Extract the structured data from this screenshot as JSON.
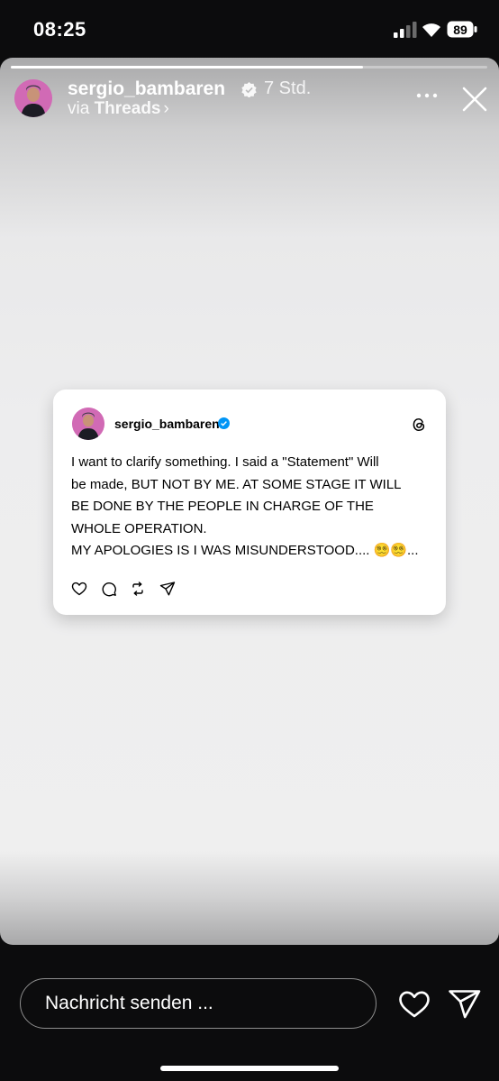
{
  "status_bar": {
    "time": "08:25",
    "battery_level": "89"
  },
  "story": {
    "progress": 0.74,
    "username": "sergio_bambaren",
    "time_ago": "7 Std.",
    "via_prefix": "via",
    "via_app": "Threads",
    "icons": {
      "more": "more-horizontal-icon",
      "close": "close-icon",
      "verified": "verified-badge-icon"
    }
  },
  "post": {
    "username": "sergio_bambaren",
    "lines": [
      "I want to clarify something. I said a \"Statement\" Will",
      "be made, BUT NOT BY ME. AT SOME STAGE IT WILL",
      "BE DONE BY THE PEOPLE IN CHARGE OF THE",
      "WHOLE OPERATION.",
      "MY APOLOGIES IS I WAS MISUNDERSTOOD.... 😵‍💫😵‍💫..."
    ],
    "icons": [
      "heart-icon",
      "comment-icon",
      "repost-icon",
      "share-icon",
      "threads-logo-icon"
    ]
  },
  "reply_bar": {
    "placeholder": "Nachricht senden ...",
    "icons": {
      "like": "heart-icon",
      "send": "send-icon"
    }
  },
  "colors": {
    "verified_blue": "#0095f6",
    "background": "#0c0c0d"
  }
}
